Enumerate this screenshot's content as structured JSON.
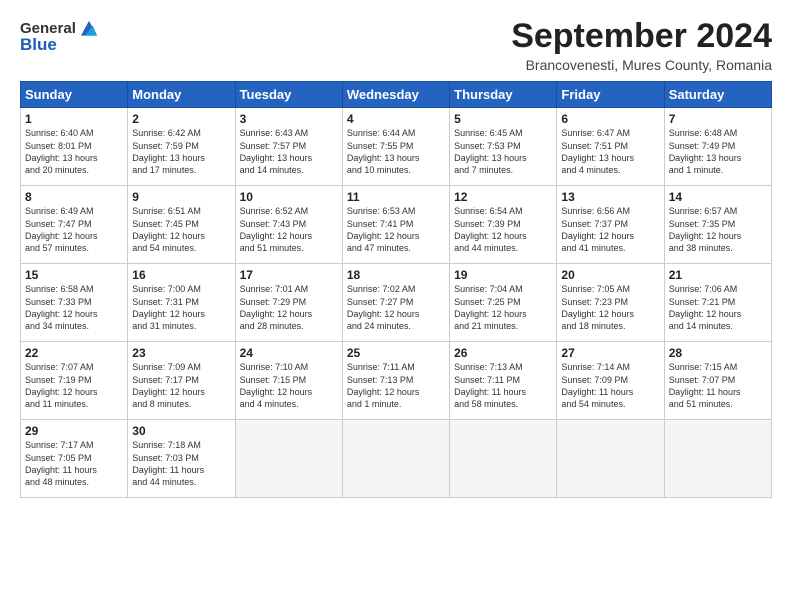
{
  "header": {
    "logo_general": "General",
    "logo_blue": "Blue",
    "month_title": "September 2024",
    "location": "Brancovenesti, Mures County, Romania"
  },
  "weekdays": [
    "Sunday",
    "Monday",
    "Tuesday",
    "Wednesday",
    "Thursday",
    "Friday",
    "Saturday"
  ],
  "weeks": [
    [
      {
        "day": 1,
        "info": "Sunrise: 6:40 AM\nSunset: 8:01 PM\nDaylight: 13 hours\nand 20 minutes."
      },
      {
        "day": 2,
        "info": "Sunrise: 6:42 AM\nSunset: 7:59 PM\nDaylight: 13 hours\nand 17 minutes."
      },
      {
        "day": 3,
        "info": "Sunrise: 6:43 AM\nSunset: 7:57 PM\nDaylight: 13 hours\nand 14 minutes."
      },
      {
        "day": 4,
        "info": "Sunrise: 6:44 AM\nSunset: 7:55 PM\nDaylight: 13 hours\nand 10 minutes."
      },
      {
        "day": 5,
        "info": "Sunrise: 6:45 AM\nSunset: 7:53 PM\nDaylight: 13 hours\nand 7 minutes."
      },
      {
        "day": 6,
        "info": "Sunrise: 6:47 AM\nSunset: 7:51 PM\nDaylight: 13 hours\nand 4 minutes."
      },
      {
        "day": 7,
        "info": "Sunrise: 6:48 AM\nSunset: 7:49 PM\nDaylight: 13 hours\nand 1 minute."
      }
    ],
    [
      {
        "day": 8,
        "info": "Sunrise: 6:49 AM\nSunset: 7:47 PM\nDaylight: 12 hours\nand 57 minutes."
      },
      {
        "day": 9,
        "info": "Sunrise: 6:51 AM\nSunset: 7:45 PM\nDaylight: 12 hours\nand 54 minutes."
      },
      {
        "day": 10,
        "info": "Sunrise: 6:52 AM\nSunset: 7:43 PM\nDaylight: 12 hours\nand 51 minutes."
      },
      {
        "day": 11,
        "info": "Sunrise: 6:53 AM\nSunset: 7:41 PM\nDaylight: 12 hours\nand 47 minutes."
      },
      {
        "day": 12,
        "info": "Sunrise: 6:54 AM\nSunset: 7:39 PM\nDaylight: 12 hours\nand 44 minutes."
      },
      {
        "day": 13,
        "info": "Sunrise: 6:56 AM\nSunset: 7:37 PM\nDaylight: 12 hours\nand 41 minutes."
      },
      {
        "day": 14,
        "info": "Sunrise: 6:57 AM\nSunset: 7:35 PM\nDaylight: 12 hours\nand 38 minutes."
      }
    ],
    [
      {
        "day": 15,
        "info": "Sunrise: 6:58 AM\nSunset: 7:33 PM\nDaylight: 12 hours\nand 34 minutes."
      },
      {
        "day": 16,
        "info": "Sunrise: 7:00 AM\nSunset: 7:31 PM\nDaylight: 12 hours\nand 31 minutes."
      },
      {
        "day": 17,
        "info": "Sunrise: 7:01 AM\nSunset: 7:29 PM\nDaylight: 12 hours\nand 28 minutes."
      },
      {
        "day": 18,
        "info": "Sunrise: 7:02 AM\nSunset: 7:27 PM\nDaylight: 12 hours\nand 24 minutes."
      },
      {
        "day": 19,
        "info": "Sunrise: 7:04 AM\nSunset: 7:25 PM\nDaylight: 12 hours\nand 21 minutes."
      },
      {
        "day": 20,
        "info": "Sunrise: 7:05 AM\nSunset: 7:23 PM\nDaylight: 12 hours\nand 18 minutes."
      },
      {
        "day": 21,
        "info": "Sunrise: 7:06 AM\nSunset: 7:21 PM\nDaylight: 12 hours\nand 14 minutes."
      }
    ],
    [
      {
        "day": 22,
        "info": "Sunrise: 7:07 AM\nSunset: 7:19 PM\nDaylight: 12 hours\nand 11 minutes."
      },
      {
        "day": 23,
        "info": "Sunrise: 7:09 AM\nSunset: 7:17 PM\nDaylight: 12 hours\nand 8 minutes."
      },
      {
        "day": 24,
        "info": "Sunrise: 7:10 AM\nSunset: 7:15 PM\nDaylight: 12 hours\nand 4 minutes."
      },
      {
        "day": 25,
        "info": "Sunrise: 7:11 AM\nSunset: 7:13 PM\nDaylight: 12 hours\nand 1 minute."
      },
      {
        "day": 26,
        "info": "Sunrise: 7:13 AM\nSunset: 7:11 PM\nDaylight: 11 hours\nand 58 minutes."
      },
      {
        "day": 27,
        "info": "Sunrise: 7:14 AM\nSunset: 7:09 PM\nDaylight: 11 hours\nand 54 minutes."
      },
      {
        "day": 28,
        "info": "Sunrise: 7:15 AM\nSunset: 7:07 PM\nDaylight: 11 hours\nand 51 minutes."
      }
    ],
    [
      {
        "day": 29,
        "info": "Sunrise: 7:17 AM\nSunset: 7:05 PM\nDaylight: 11 hours\nand 48 minutes."
      },
      {
        "day": 30,
        "info": "Sunrise: 7:18 AM\nSunset: 7:03 PM\nDaylight: 11 hours\nand 44 minutes."
      },
      null,
      null,
      null,
      null,
      null
    ]
  ]
}
